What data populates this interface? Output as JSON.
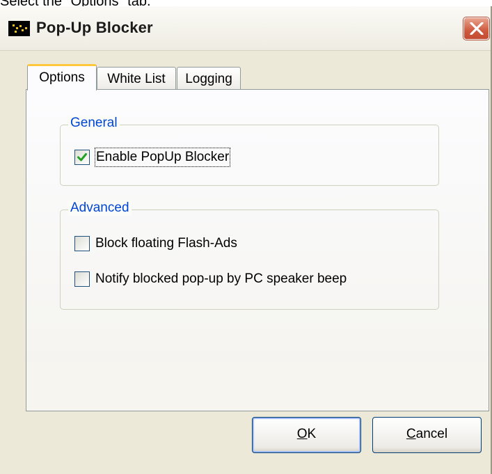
{
  "caption": "Select the \"Options\" tab.",
  "window": {
    "title": "Pop-Up Blocker",
    "close_icon": "close-x-icon"
  },
  "tabs": [
    {
      "label": "Options",
      "active": true
    },
    {
      "label": "White List",
      "active": false
    },
    {
      "label": "Logging",
      "active": false
    }
  ],
  "groups": {
    "general": {
      "title": "General",
      "options": [
        {
          "label": "Enable PopUp Blocker",
          "checked": true
        }
      ]
    },
    "advanced": {
      "title": "Advanced",
      "options": [
        {
          "label": "Block floating Flash-Ads",
          "checked": false
        },
        {
          "label": "Notify blocked pop-up by PC speaker beep",
          "checked": false
        }
      ]
    }
  },
  "buttons": {
    "ok": {
      "mnemonic": "O",
      "rest": "K"
    },
    "cancel": {
      "mnemonic": "C",
      "rest": "ancel"
    }
  },
  "colors": {
    "group_title": "#0046d5",
    "active_tab_highlight": "#ffc83c",
    "checkmark": "#21a121",
    "close_button": "#cf5a3f"
  }
}
